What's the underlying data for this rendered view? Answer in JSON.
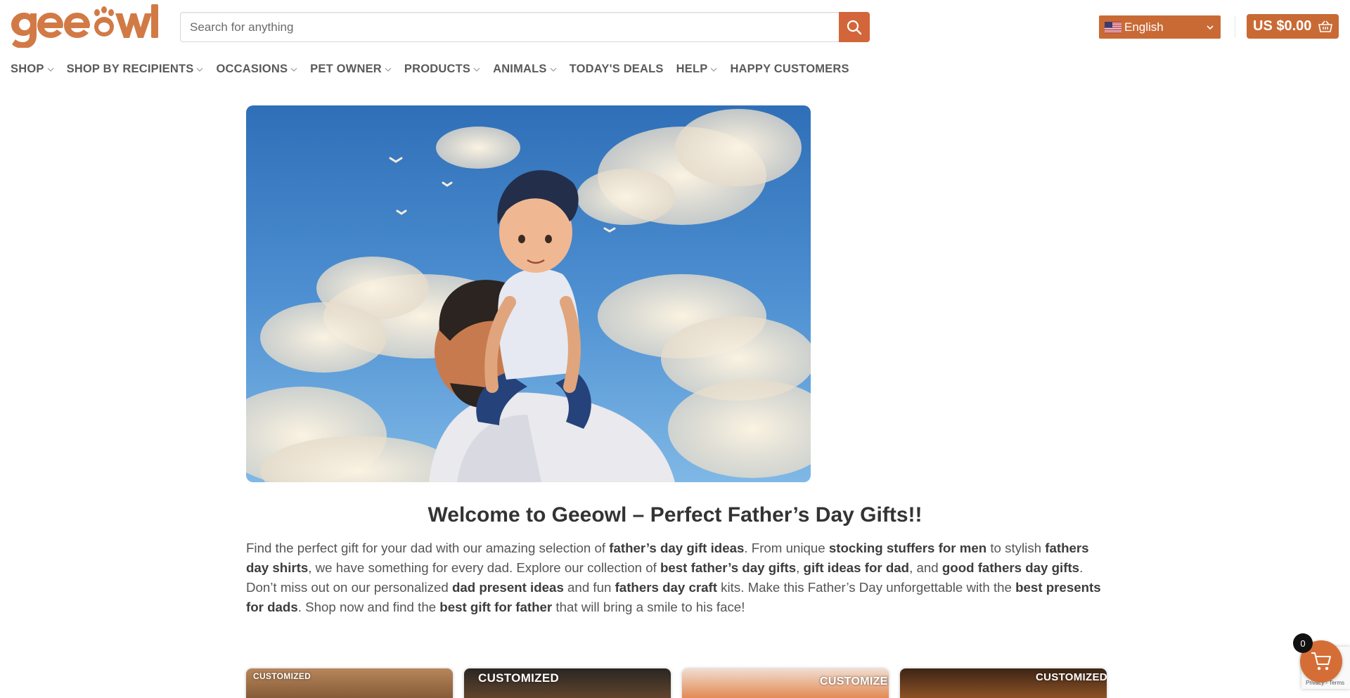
{
  "brand": {
    "name": "geeowl",
    "color": "#d27a46"
  },
  "search": {
    "placeholder": "Search for anything",
    "value": ""
  },
  "language": {
    "selected": "English",
    "flag": "us-flag"
  },
  "cart": {
    "amount": "US $0.00",
    "count": "0"
  },
  "nav": [
    {
      "label": "SHOP",
      "dropdown": true
    },
    {
      "label": "SHOP BY RECIPIENTS",
      "dropdown": true
    },
    {
      "label": "OCCASIONS",
      "dropdown": true
    },
    {
      "label": "PET OWNER",
      "dropdown": true
    },
    {
      "label": "PRODUCTS",
      "dropdown": true
    },
    {
      "label": "ANIMALS",
      "dropdown": true
    },
    {
      "label": "TODAY'S DEALS",
      "dropdown": false
    },
    {
      "label": "HELP",
      "dropdown": true
    },
    {
      "label": "HAPPY CUSTOMERS",
      "dropdown": false
    }
  ],
  "main": {
    "welcome": "Welcome to Geeowl – Perfect Father’s Day Gifts!!",
    "intro": [
      {
        "t": "Find the perfect gift for your dad with our amazing selection of "
      },
      {
        "t": "father’s day gift ideas",
        "b": true
      },
      {
        "t": ". From unique "
      },
      {
        "t": "stocking stuffers for men",
        "b": true
      },
      {
        "t": " to stylish "
      },
      {
        "t": "fathers day shirts",
        "b": true
      },
      {
        "t": ", we have something for every dad. Explore our collection of "
      },
      {
        "t": "best father’s day gifts",
        "b": true
      },
      {
        "t": ", "
      },
      {
        "t": "gift ideas for dad",
        "b": true
      },
      {
        "t": ", and "
      },
      {
        "t": "good fathers day gifts",
        "b": true
      },
      {
        "t": ". Don’t miss out on our personalized "
      },
      {
        "t": "dad present ideas",
        "b": true
      },
      {
        "t": " and fun "
      },
      {
        "t": "fathers day craft",
        "b": true
      },
      {
        "t": " kits. Make this Father’s Day unforgettable with the "
      },
      {
        "t": "best presents for dads",
        "b": true
      },
      {
        "t": ". Shop now and find the "
      },
      {
        "t": "best gift for father",
        "b": true
      },
      {
        "t": " that will bring a smile to his face!"
      }
    ]
  },
  "cards": [
    {
      "badge": "CUSTOMIZED"
    },
    {
      "badge": "CUSTOMIZED"
    },
    {
      "badge": "CUSTOMIZED"
    },
    {
      "badge": "CUSTOMIZED"
    }
  ],
  "recaptcha": {
    "text": "Privacy - Terms"
  },
  "colors": {
    "accent": "#c96a35",
    "search_button": "#d2663a",
    "text": "#555555"
  }
}
